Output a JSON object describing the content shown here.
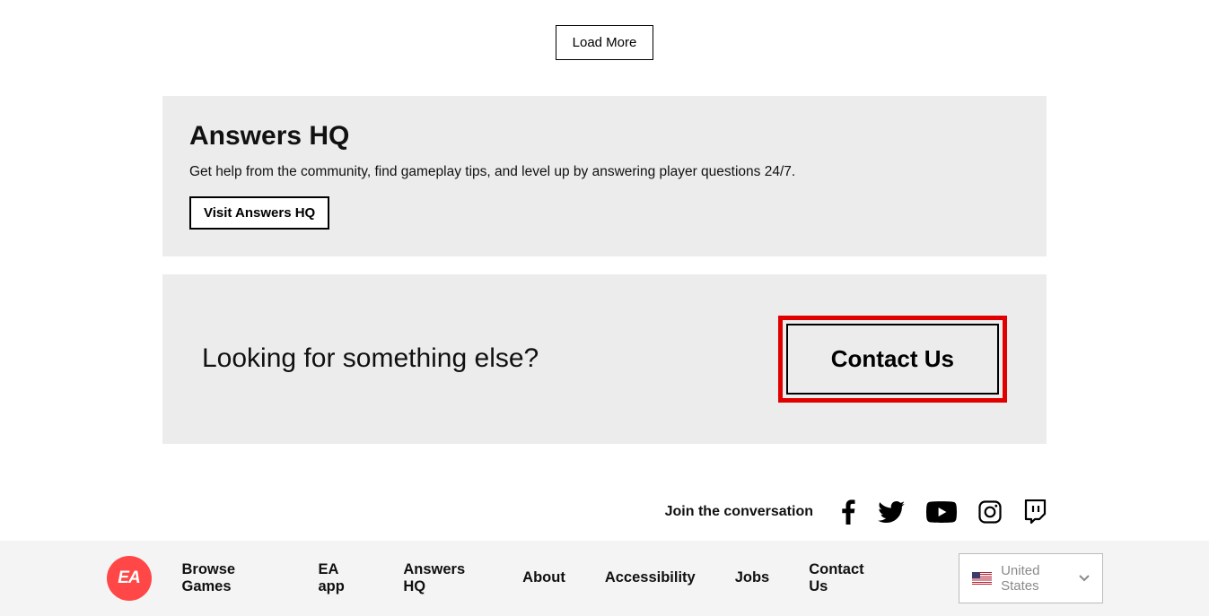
{
  "load_more_label": "Load More",
  "answers_card": {
    "title": "Answers HQ",
    "desc": "Get help from the community, find gameplay tips, and level up by answering player questions 24/7.",
    "button": "Visit Answers HQ"
  },
  "contact_card": {
    "title": "Looking for something else?",
    "button": "Contact Us"
  },
  "social": {
    "text": "Join the conversation"
  },
  "footer": {
    "links": {
      "browse": "Browse Games",
      "app": "EA app",
      "answers": "Answers HQ",
      "about": "About",
      "accessibility": "Accessibility",
      "jobs": "Jobs",
      "contact": "Contact Us"
    },
    "country": "United States"
  }
}
